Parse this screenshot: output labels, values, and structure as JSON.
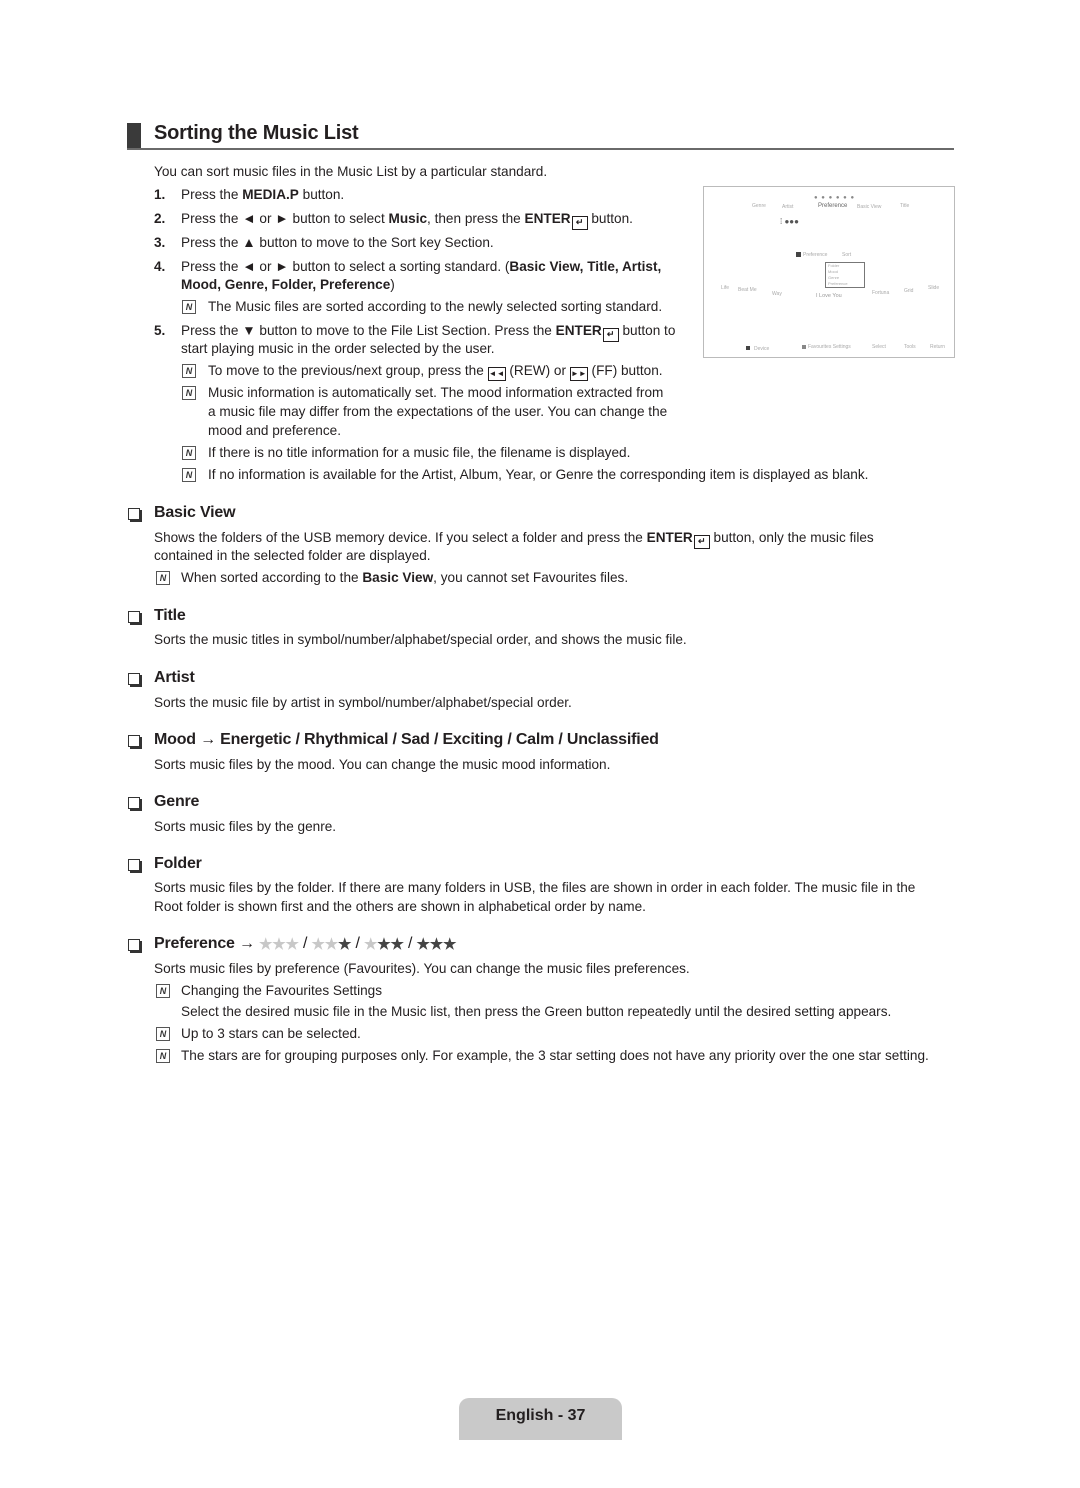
{
  "section": {
    "title": "Sorting the Music List",
    "intro": "You can sort music files in the Music List by a particular standard."
  },
  "steps": [
    {
      "num": "1.",
      "pre": "Press the ",
      "bold": "MEDIA.P",
      "post": " button."
    },
    {
      "num": "2.",
      "pre": "Press the ◄ or ► button to select ",
      "bold": "Music",
      "mid": ", then press the ",
      "bold2": "ENTER",
      "post": " button."
    },
    {
      "num": "3.",
      "text": "Press the ▲ button to move to the Sort key Section."
    },
    {
      "num": "4.",
      "pre": "Press the ◄ or ► button to select a sorting standard. (",
      "bold": "Basic View, Title, Artist,",
      "line2_bold": "Mood, Genre, Folder, Preference",
      "line2_post": ")"
    },
    {
      "num": "5.",
      "pre": "Press the ▼ button to move to the File List Section.  Press the ",
      "bold": "ENTER",
      "post": " button to",
      "line2": "start playing music in the order selected by the user."
    }
  ],
  "notes": {
    "step4_note": "The Music files are sorted according to the newly selected sorting standard.",
    "step5_notes": [
      {
        "pre": "To move to the previous/next group, press the ",
        "rew": "◄◄",
        "mid": " (REW) or ",
        "ff": "►►",
        "post": " (FF) button."
      },
      {
        "lines": [
          "Music information is automatically set. The mood information extracted from",
          "a music file may differ from the expectations of the user. You can change the",
          "mood and preference."
        ]
      },
      {
        "text": "If there is no title information for a music file, the filename is displayed."
      },
      {
        "text": "If no information is available for the Artist, Album, Year, or Genre the corresponding item is displayed as blank."
      }
    ]
  },
  "screen": {
    "tabs": [
      "Genre",
      "Artist",
      "Preference",
      "Basic View",
      "Title"
    ],
    "sort_label": "Sort",
    "list_items": [
      "Folder",
      "Mood",
      "Genre",
      "Preference"
    ],
    "files": [
      "Life",
      "Beat Me",
      "Way",
      "I Love You",
      "Fortuna",
      "Grid",
      "Slide"
    ],
    "footer": {
      "device": "Device",
      "fav": "Favourites Settings",
      "select": "Select",
      "tools": "Tools",
      "return": "Return"
    }
  },
  "subsections": [
    {
      "heading": "Basic View",
      "lines_pre": "Shows the folders of the USB memory device. If you select a folder and press the ",
      "lines_bold": "ENTER",
      "lines_post": " button, only the music files",
      "line2": "contained in the selected folder are displayed.",
      "note_pre": "When sorted according to the ",
      "note_bold": "Basic View",
      "note_post": ", you cannot set Favourites files."
    },
    {
      "heading": "Title",
      "text": "Sorts the music titles in symbol/number/alphabet/special order, and shows the music file."
    },
    {
      "heading": "Artist",
      "text": "Sorts the music file by artist in symbol/number/alphabet/special order."
    },
    {
      "heading": "Mood → Energetic / Rhythmical / Sad / Exciting / Calm / Unclassified",
      "text": "Sorts music files by the mood. You can change the music mood information."
    },
    {
      "heading": "Genre",
      "text": "Sorts music files by the genre."
    },
    {
      "heading": "Folder",
      "lines": [
        "Sorts music files by the folder. If there are many folders in USB, the files are shown in order in each folder. The music file in the",
        "Root folder is shown first and the others are shown in alphabetical order by name."
      ]
    },
    {
      "heading": "Preference →",
      "star_sets": [
        0,
        1,
        2,
        3
      ],
      "text": "Sorts music files by preference (Favourites). You can change the music files preferences.",
      "notes": [
        {
          "text": "Changing the Favourites Settings",
          "detail": "Select the desired music file in the Music list, then press the Green button repeatedly until the desired setting appears."
        },
        {
          "text": "Up to 3 stars can be selected."
        },
        {
          "text": "The stars are for grouping purposes only. For example, the 3 star setting does not have any priority over the one star setting."
        }
      ]
    }
  ],
  "footer": {
    "page_label": "English - 37"
  },
  "icons": {
    "note": "N",
    "enter": "↵",
    "section_bullet": "❑"
  }
}
